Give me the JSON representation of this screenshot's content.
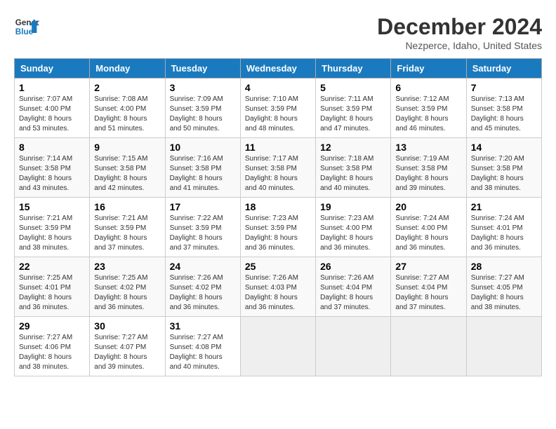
{
  "logo": {
    "text_general": "General",
    "text_blue": "Blue"
  },
  "header": {
    "title": "December 2024",
    "subtitle": "Nezperce, Idaho, United States"
  },
  "weekdays": [
    "Sunday",
    "Monday",
    "Tuesday",
    "Wednesday",
    "Thursday",
    "Friday",
    "Saturday"
  ],
  "weeks": [
    [
      {
        "day": "1",
        "sunrise": "7:07 AM",
        "sunset": "4:00 PM",
        "daylight": "8 hours and 53 minutes."
      },
      {
        "day": "2",
        "sunrise": "7:08 AM",
        "sunset": "4:00 PM",
        "daylight": "8 hours and 51 minutes."
      },
      {
        "day": "3",
        "sunrise": "7:09 AM",
        "sunset": "3:59 PM",
        "daylight": "8 hours and 50 minutes."
      },
      {
        "day": "4",
        "sunrise": "7:10 AM",
        "sunset": "3:59 PM",
        "daylight": "8 hours and 48 minutes."
      },
      {
        "day": "5",
        "sunrise": "7:11 AM",
        "sunset": "3:59 PM",
        "daylight": "8 hours and 47 minutes."
      },
      {
        "day": "6",
        "sunrise": "7:12 AM",
        "sunset": "3:59 PM",
        "daylight": "8 hours and 46 minutes."
      },
      {
        "day": "7",
        "sunrise": "7:13 AM",
        "sunset": "3:58 PM",
        "daylight": "8 hours and 45 minutes."
      }
    ],
    [
      {
        "day": "8",
        "sunrise": "7:14 AM",
        "sunset": "3:58 PM",
        "daylight": "8 hours and 43 minutes."
      },
      {
        "day": "9",
        "sunrise": "7:15 AM",
        "sunset": "3:58 PM",
        "daylight": "8 hours and 42 minutes."
      },
      {
        "day": "10",
        "sunrise": "7:16 AM",
        "sunset": "3:58 PM",
        "daylight": "8 hours and 41 minutes."
      },
      {
        "day": "11",
        "sunrise": "7:17 AM",
        "sunset": "3:58 PM",
        "daylight": "8 hours and 40 minutes."
      },
      {
        "day": "12",
        "sunrise": "7:18 AM",
        "sunset": "3:58 PM",
        "daylight": "8 hours and 40 minutes."
      },
      {
        "day": "13",
        "sunrise": "7:19 AM",
        "sunset": "3:58 PM",
        "daylight": "8 hours and 39 minutes."
      },
      {
        "day": "14",
        "sunrise": "7:20 AM",
        "sunset": "3:58 PM",
        "daylight": "8 hours and 38 minutes."
      }
    ],
    [
      {
        "day": "15",
        "sunrise": "7:21 AM",
        "sunset": "3:59 PM",
        "daylight": "8 hours and 38 minutes."
      },
      {
        "day": "16",
        "sunrise": "7:21 AM",
        "sunset": "3:59 PM",
        "daylight": "8 hours and 37 minutes."
      },
      {
        "day": "17",
        "sunrise": "7:22 AM",
        "sunset": "3:59 PM",
        "daylight": "8 hours and 37 minutes."
      },
      {
        "day": "18",
        "sunrise": "7:23 AM",
        "sunset": "3:59 PM",
        "daylight": "8 hours and 36 minutes."
      },
      {
        "day": "19",
        "sunrise": "7:23 AM",
        "sunset": "4:00 PM",
        "daylight": "8 hours and 36 minutes."
      },
      {
        "day": "20",
        "sunrise": "7:24 AM",
        "sunset": "4:00 PM",
        "daylight": "8 hours and 36 minutes."
      },
      {
        "day": "21",
        "sunrise": "7:24 AM",
        "sunset": "4:01 PM",
        "daylight": "8 hours and 36 minutes."
      }
    ],
    [
      {
        "day": "22",
        "sunrise": "7:25 AM",
        "sunset": "4:01 PM",
        "daylight": "8 hours and 36 minutes."
      },
      {
        "day": "23",
        "sunrise": "7:25 AM",
        "sunset": "4:02 PM",
        "daylight": "8 hours and 36 minutes."
      },
      {
        "day": "24",
        "sunrise": "7:26 AM",
        "sunset": "4:02 PM",
        "daylight": "8 hours and 36 minutes."
      },
      {
        "day": "25",
        "sunrise": "7:26 AM",
        "sunset": "4:03 PM",
        "daylight": "8 hours and 36 minutes."
      },
      {
        "day": "26",
        "sunrise": "7:26 AM",
        "sunset": "4:04 PM",
        "daylight": "8 hours and 37 minutes."
      },
      {
        "day": "27",
        "sunrise": "7:27 AM",
        "sunset": "4:04 PM",
        "daylight": "8 hours and 37 minutes."
      },
      {
        "day": "28",
        "sunrise": "7:27 AM",
        "sunset": "4:05 PM",
        "daylight": "8 hours and 38 minutes."
      }
    ],
    [
      {
        "day": "29",
        "sunrise": "7:27 AM",
        "sunset": "4:06 PM",
        "daylight": "8 hours and 38 minutes."
      },
      {
        "day": "30",
        "sunrise": "7:27 AM",
        "sunset": "4:07 PM",
        "daylight": "8 hours and 39 minutes."
      },
      {
        "day": "31",
        "sunrise": "7:27 AM",
        "sunset": "4:08 PM",
        "daylight": "8 hours and 40 minutes."
      },
      null,
      null,
      null,
      null
    ]
  ],
  "labels": {
    "sunrise": "Sunrise:",
    "sunset": "Sunset:",
    "daylight": "Daylight:"
  }
}
